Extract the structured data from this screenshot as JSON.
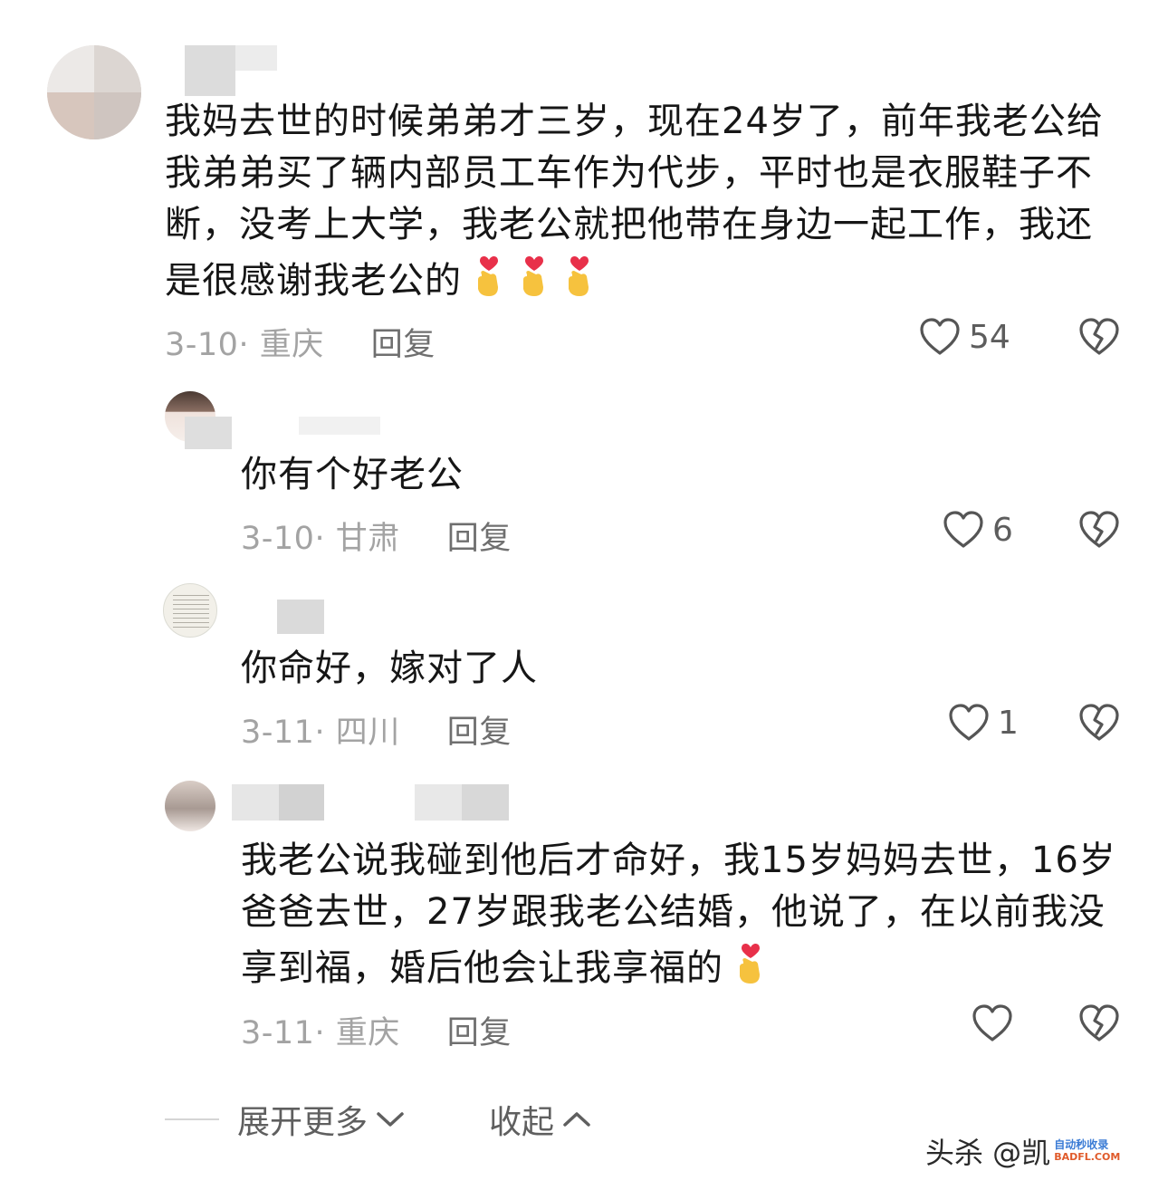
{
  "comments": [
    {
      "text": "我妈去世的时候弟弟才三岁，现在24岁了，前年我老公给我弟弟买了辆内部员工车作为代步，平时也是衣服鞋子不断，没考上大学，我老公就把他带在身边一起工作，我还是很感谢我老公的",
      "emoji_count": 3,
      "date": "3-10",
      "location": "重庆",
      "reply_label": "回复",
      "likes": "54"
    }
  ],
  "replies": [
    {
      "text": "你有个好老公",
      "date": "3-10",
      "location": "甘肃",
      "reply_label": "回复",
      "likes": "6"
    },
    {
      "text": "你命好，嫁对了人",
      "date": "3-11",
      "location": "四川",
      "reply_label": "回复",
      "likes": "1"
    },
    {
      "text": "我老公说我碰到他后才命好，我15岁妈妈去世，16岁爸爸去世，27岁跟我老公结婚，他说了，在以前我没享到福，婚后他会让我享福的",
      "emoji_count": 1,
      "date": "3-11",
      "location": "重庆",
      "reply_label": "回复",
      "likes": ""
    }
  ],
  "footer": {
    "expand_label": "展开更多",
    "collapse_label": "收起"
  },
  "watermark": {
    "text": "头杀 @凯",
    "logo_text": "自动秒收录",
    "logo_sub": "BADFL.COM"
  },
  "icons": {
    "like": "heart-outline-icon",
    "dislike": "broken-heart-icon",
    "emoji": "finger-heart-emoji"
  },
  "colors": {
    "text": "#161616",
    "meta": "#a3a3a3",
    "reply": "#6f6f6f",
    "heart_stroke": "#555555",
    "emoji_heart": "#e8304a",
    "emoji_hand": "#f6c23e"
  }
}
